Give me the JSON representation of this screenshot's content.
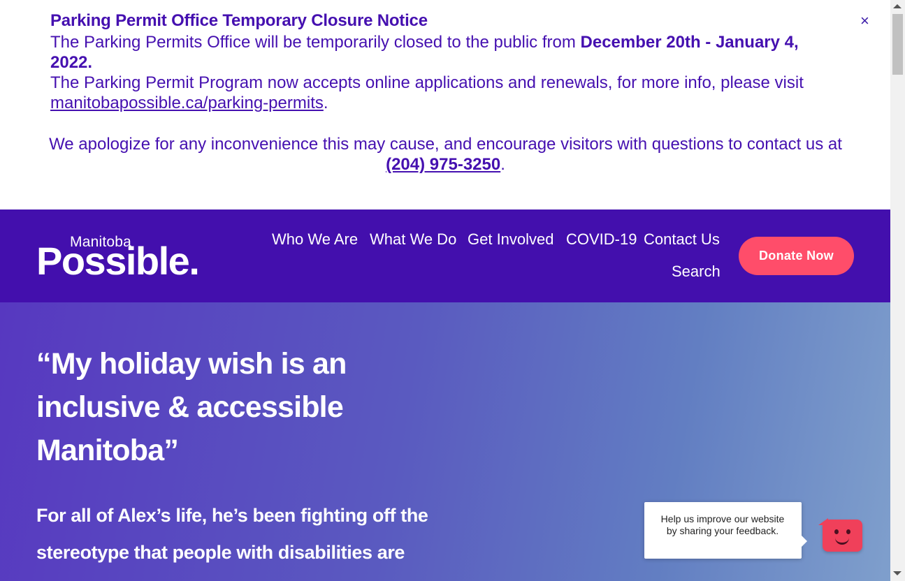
{
  "notice": {
    "title": "Parking Permit Office Temporary Closure Notice",
    "line1_text": "The Parking Permits Office will be temporarily closed to the public from ",
    "line1_bold": "December 20th - January 4, 2022.",
    "line2_text": "The Parking Permit Program now accepts online applications and renewals, for more info, please visit ",
    "link_text": "manitobapossible.ca/parking-permits",
    "link_suffix": ".",
    "apology_text": "We apologize for any inconvenience this may cause, and encourage visitors with questions  to contact us at",
    "phone": "(204) 975-3250",
    "phone_suffix": ".",
    "close_label": "×"
  },
  "header": {
    "logo_small": "Manitoba",
    "logo_big": "Possible.",
    "nav": [
      {
        "label": "Who We Are"
      },
      {
        "label": "What We Do"
      },
      {
        "label": "Get Involved"
      },
      {
        "label": "COVID-19"
      },
      {
        "label": "Contact Us"
      }
    ],
    "search_label": "Search",
    "donate_label": "Donate Now"
  },
  "hero": {
    "title": "“My holiday wish is an inclusive & accessible Manitoba”",
    "text": "For all of Alex’s life, he’s been fighting off the stereotype that people with disabilities are"
  },
  "feedback": {
    "text": "Help us improve our website by sharing your feedback."
  },
  "colors": {
    "brand_purple": "#430fad",
    "notice_text": "#4510b0",
    "donate": "#ff4d6a",
    "feedback": "#f0405a"
  }
}
